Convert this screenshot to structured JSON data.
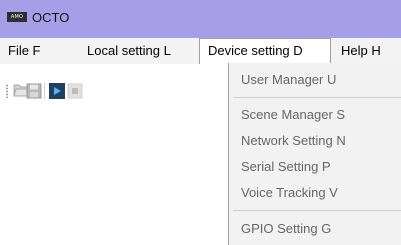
{
  "app": {
    "title": "OCTO",
    "logo_text": "AMO"
  },
  "menubar": {
    "items": [
      {
        "label": "File F"
      },
      {
        "label": "Local setting L"
      },
      {
        "label": "Device setting D"
      },
      {
        "label": "Help H"
      }
    ],
    "active_index": 2
  },
  "toolbar": {
    "icons": [
      "open-folder-icon",
      "save-icon",
      "play-icon",
      "stop-icon"
    ]
  },
  "device_menu": {
    "items": [
      {
        "label": "User Manager U"
      },
      {
        "label": "Scene Manager S"
      },
      {
        "label": "Network Setting N"
      },
      {
        "label": "Serial Setting P"
      },
      {
        "label": "Voice Tracking V"
      },
      {
        "label": "GPIO Setting G"
      }
    ]
  },
  "colors": {
    "titlebar": "#a69ee6",
    "menubar": "#f3f3f3",
    "dropdown_bg": "#f2f2f2",
    "disabled_text": "#666666",
    "play_icon_bg": "#1f3f63",
    "play_icon_fg": "#4fb7f0"
  }
}
